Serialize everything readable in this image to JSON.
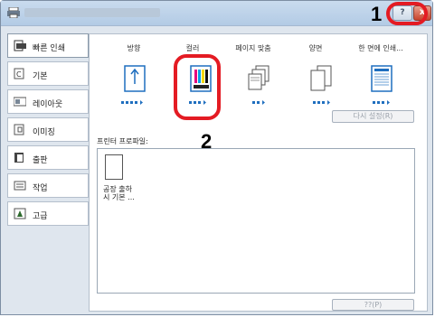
{
  "annotations": {
    "marker1": "1",
    "marker2": "2"
  },
  "titlebar": {
    "help_label": "?",
    "close_label": "x"
  },
  "sidebar": {
    "items": [
      {
        "label": "빠른 인쇄",
        "icon": "quick-print-icon",
        "active": true
      },
      {
        "label": "기본",
        "icon": "basic-icon"
      },
      {
        "label": "레이아웃",
        "icon": "layout-icon"
      },
      {
        "label": "이미징",
        "icon": "imaging-icon"
      },
      {
        "label": "출판",
        "icon": "publishing-icon"
      },
      {
        "label": "작업",
        "icon": "job-icon"
      },
      {
        "label": "고급",
        "icon": "advanced-icon"
      }
    ]
  },
  "quick_print": {
    "columns": [
      {
        "label": "방향",
        "icon": "orientation-icon"
      },
      {
        "label": "컬러",
        "icon": "color-icon"
      },
      {
        "label": "페이지 맞춤",
        "icon": "page-fit-icon"
      },
      {
        "label": "양면",
        "icon": "duplex-icon"
      },
      {
        "label": "한 면에 인쇄...",
        "icon": "multi-up-icon"
      }
    ],
    "reset_label": "다시 설정(R)",
    "profile_label": "프린터 프로파일:",
    "profile_item_label": "공장 출하 시 기본 ...",
    "bottom_button_label": "??(P)"
  },
  "colors": {
    "accent_red": "#e41b23",
    "window_bg": "#dfe6ee",
    "selected_blue": "#1f6fbf"
  }
}
